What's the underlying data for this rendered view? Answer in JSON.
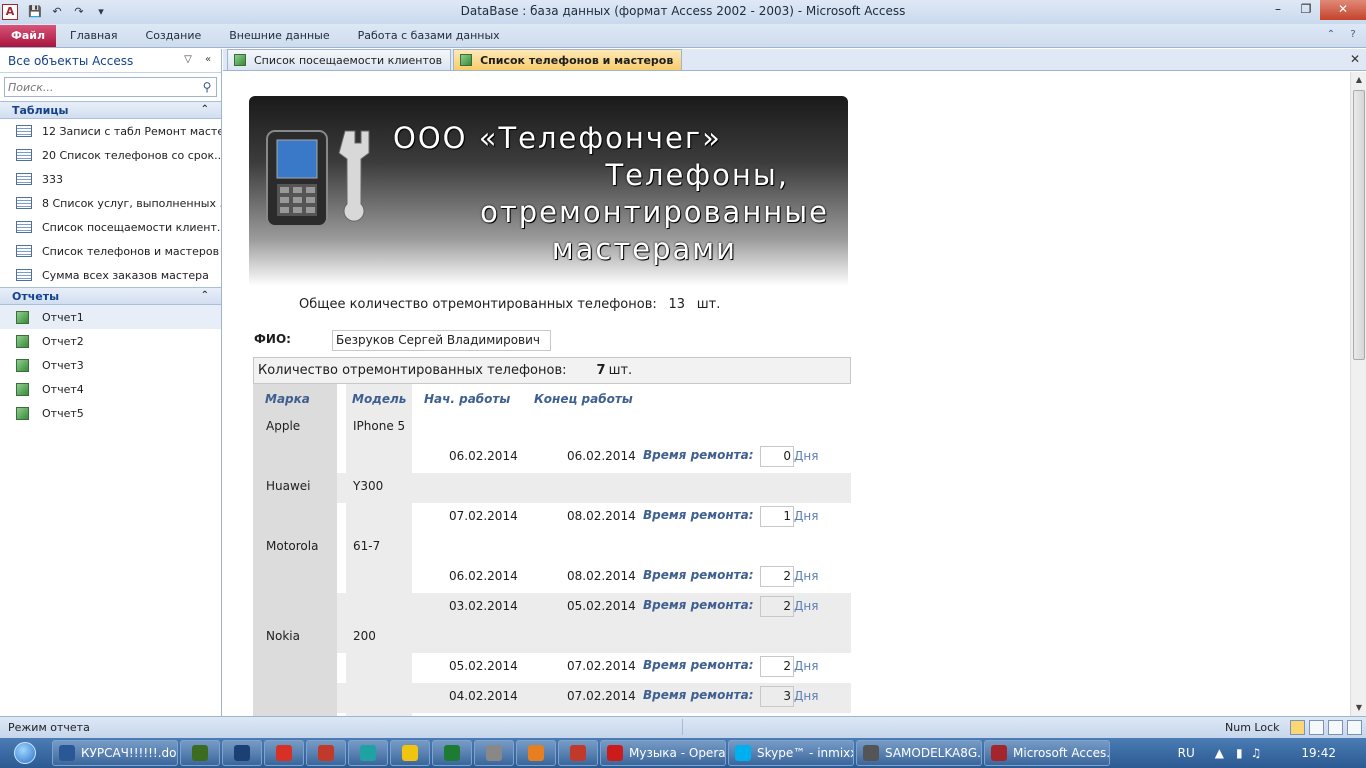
{
  "window": {
    "title": "DataBase : база данных (формат Access 2002 - 2003)  -  Microsoft Access",
    "app_icon_letter": "A"
  },
  "ribbon": {
    "file_tab": "Файл",
    "tabs": [
      "Главная",
      "Создание",
      "Внешние данные",
      "Работа с базами данных"
    ]
  },
  "nav": {
    "title": "Все объекты Access",
    "search_placeholder": "Поиск...",
    "groups": [
      {
        "name": "Таблицы",
        "items": [
          "12 Записи с табл Ремонт масте...",
          "20 Список телефонов со срок...",
          "333",
          "8 Список услуг, выполненных ...",
          "Список посещаемости клиент...",
          "Список телефонов и мастеров",
          "Сумма всех заказов мастера"
        ]
      },
      {
        "name": "Отчеты",
        "items": [
          "Отчет1",
          "Отчет2",
          "Отчет3",
          "Отчет4",
          "Отчет5"
        ]
      }
    ]
  },
  "doc_tabs": [
    {
      "label": "Список посещаемости клиентов",
      "active": false
    },
    {
      "label": "Список телефонов и мастеров",
      "active": true
    }
  ],
  "report": {
    "banner": {
      "line1": "ООО «Телефончег»",
      "line2": "Телефоны,",
      "line3": "отремонтированные",
      "line4": "мастерами"
    },
    "total_label": "Общее количество отремонтированных телефонов:",
    "total_value": "13",
    "total_unit": "шт.",
    "fio_label": "ФИО:",
    "fio_value": "Безруков Сергей Владимирович",
    "count_label": "Количество отремонтированных телефонов:",
    "count_value": "7",
    "count_unit": "шт.",
    "headers": {
      "brand": "Марка",
      "model": "Модель",
      "start": "Нач. работы",
      "end": "Конец  работы"
    },
    "repair_label": "Время ремонта:",
    "days_unit": "Дня",
    "brands": [
      {
        "brand": "Apple",
        "model": "IPhone 5"
      },
      {
        "brand": "Huawei",
        "model": "Y300"
      },
      {
        "brand": "Motorola",
        "model": "61-7"
      },
      {
        "brand": "Nokia",
        "model": "200"
      }
    ],
    "rows": [
      {
        "start": "06.02.2014",
        "end": "06.02.2014",
        "days": "0"
      },
      {
        "start": "07.02.2014",
        "end": "08.02.2014",
        "days": "1"
      },
      {
        "start": "06.02.2014",
        "end": "08.02.2014",
        "days": "2"
      },
      {
        "start": "03.02.2014",
        "end": "05.02.2014",
        "days": "2"
      },
      {
        "start": "05.02.2014",
        "end": "07.02.2014",
        "days": "2"
      },
      {
        "start": "04.02.2014",
        "end": "07.02.2014",
        "days": "3"
      }
    ]
  },
  "status": {
    "mode": "Режим отчета",
    "numlock": "Num Lock"
  },
  "taskbar": {
    "items": [
      {
        "label": "КУРСАЧ!!!!!!.doc...",
        "color": "#2b5797"
      },
      {
        "label": "",
        "color": "#3d6b1f"
      },
      {
        "label": "",
        "color": "#1c3f74"
      },
      {
        "label": "",
        "color": "#d93025"
      },
      {
        "label": "",
        "color": "#c0392b"
      },
      {
        "label": "",
        "color": "#1fa2a2"
      },
      {
        "label": "",
        "color": "#f1c40f"
      },
      {
        "label": "",
        "color": "#1e7b34"
      },
      {
        "label": "",
        "color": "#888888"
      },
      {
        "label": "",
        "color": "#e67e22"
      },
      {
        "label": "",
        "color": "#c0392b"
      },
      {
        "label": "Музыка - Opera",
        "color": "#cc1b1b"
      },
      {
        "label": "Skype™ - inmixxx",
        "color": "#00aff0"
      },
      {
        "label": "SAMODELKA8G...",
        "color": "#555555"
      },
      {
        "label": "Microsoft Acces...",
        "color": "#a4262c"
      }
    ],
    "lang": "RU",
    "clock": "19:42"
  }
}
